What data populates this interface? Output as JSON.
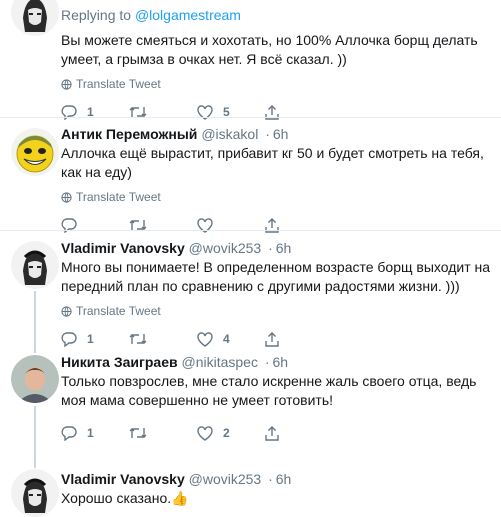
{
  "tweets": [
    {
      "replying_prefix": "Replying to",
      "replying_handle": "@lolgamestream",
      "text": "Вы можете смеяться и хохотать, но 100% Аллочка борщ делать умеет, а грымза в очках нет. Я всё сказал. ))",
      "translate": "Translate Tweet",
      "replies": "1",
      "retweets": "",
      "likes": "5"
    },
    {
      "name": "Антик Переможный",
      "handle": "@iskakol",
      "time": "6h",
      "text": "Аллочка ещё вырастит, прибавит кг 50 и будет смотреть на тебя, как на еду)",
      "translate": "Translate Tweet",
      "replies": "",
      "retweets": "",
      "likes": ""
    },
    {
      "name": "Vladimir Vanovsky",
      "handle": "@wovik253",
      "time": "6h",
      "text": "Много вы понимаете! В определенном возрасте борщ выходит на передний план по сравнению с другими радостями жизни. )))",
      "translate": "Translate Tweet",
      "replies": "1",
      "retweets": "",
      "likes": "4"
    },
    {
      "name": "Никита Заиграев",
      "handle": "@nikitaspec",
      "time": "6h",
      "text": "Только повзрослев, мне стало искренне жаль своего отца, ведь моя мама совершенно не умеет готовить!",
      "translate": "",
      "replies": "1",
      "retweets": "",
      "likes": "2"
    },
    {
      "name": "Vladimir Vanovsky",
      "handle": "@wovik253",
      "time": "6h",
      "text": "Хорошо сказано.",
      "emoji": "👍"
    }
  ],
  "colors": {
    "link": "#1da1f2",
    "muted": "#657786",
    "divider": "#e6ecf0",
    "text": "#14171a"
  },
  "icons": [
    "globe-icon",
    "reply-icon",
    "retweet-icon",
    "like-icon",
    "share-icon"
  ]
}
